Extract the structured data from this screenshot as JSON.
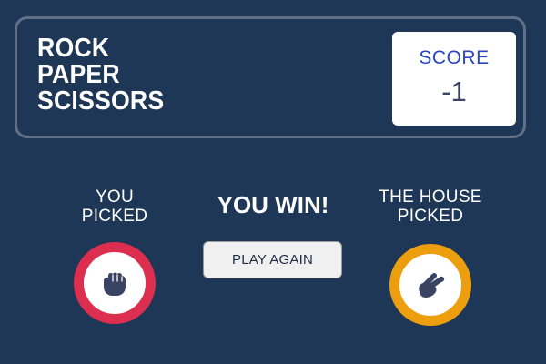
{
  "header": {
    "title_lines": [
      "ROCK",
      "PAPER",
      "SCISSORS"
    ],
    "score_label": "SCORE",
    "score_value": "-1"
  },
  "game": {
    "player_label_lines": [
      "YOU",
      "PICKED"
    ],
    "house_label_lines": [
      "THE HOUSE",
      "PICKED"
    ],
    "result_text": "YOU WIN!",
    "play_again_label": "PLAY AGAIN",
    "player_pick": "rock",
    "house_pick": "scissors"
  },
  "colors": {
    "background": "#1f3756",
    "header_border": "#5f7088",
    "rock_ring": "#dc2e4e",
    "scissors_ring": "#ec9e0e",
    "score_label": "#2a46c0",
    "icon": "#3b4363"
  },
  "icons": {
    "player_pick_icon": "rock-fist-icon",
    "house_pick_icon": "scissors-hand-icon"
  }
}
